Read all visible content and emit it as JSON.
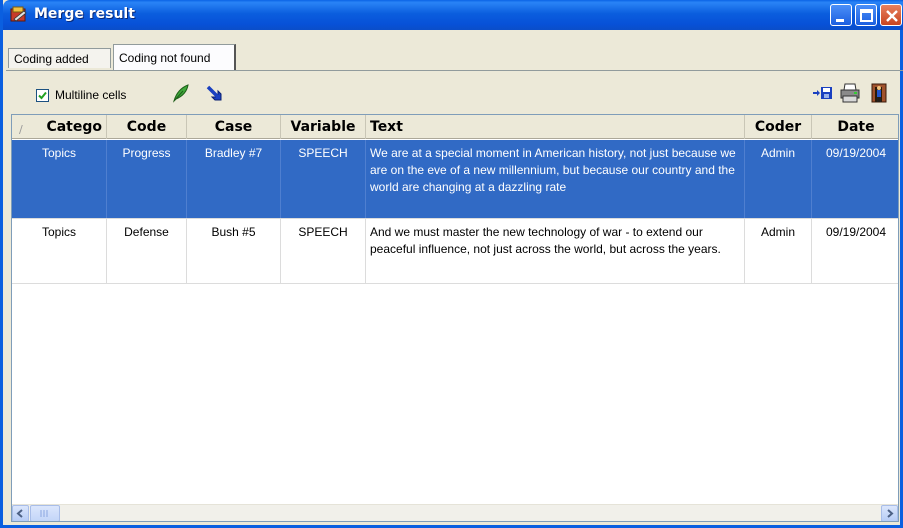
{
  "window": {
    "title": "Merge result",
    "icon": "app-icon"
  },
  "tabs": [
    {
      "label": "Coding added",
      "active": false
    },
    {
      "label": "Coding not found",
      "active": true
    }
  ],
  "toolbar": {
    "multiline_label": "Multiline cells",
    "multiline_checked": true,
    "icons": [
      "feather-icon",
      "arrow-icon",
      "export-icon",
      "print-icon",
      "exit-icon"
    ]
  },
  "grid": {
    "columns": [
      "Catego",
      "Code",
      "Case",
      "Variable",
      "Text",
      "Coder",
      "Date"
    ],
    "rows": [
      {
        "selected": true,
        "category": "Topics",
        "code": "Progress",
        "case": "Bradley #7",
        "variable": "SPEECH",
        "text": "We are at a special moment in American history, not just because we are on the eve of a new millennium, but because our country and the world are changing at a dazzling rate",
        "coder": "Admin",
        "date": "09/19/2004"
      },
      {
        "selected": false,
        "category": "Topics",
        "code": "Defense",
        "case": "Bush #5",
        "variable": "SPEECH",
        "text": "And we must master the new technology of war - to extend our peaceful influence, not just across the world, but across the years.",
        "coder": "Admin",
        "date": "09/19/2004"
      }
    ]
  },
  "colors": {
    "titlebar": "#0b5ede",
    "selection": "#316ac5"
  }
}
